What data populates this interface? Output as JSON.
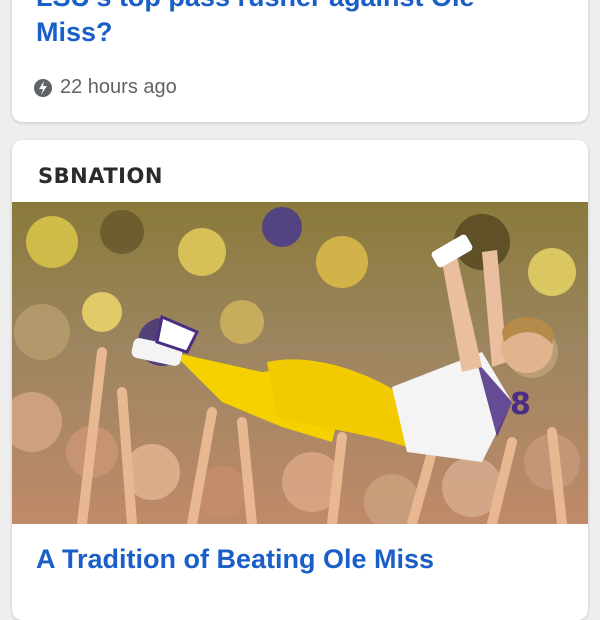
{
  "top_card": {
    "title_line1": "LSU's top pass rusher against Ole",
    "title_line2": "Miss?",
    "time": "22 hours ago"
  },
  "bottom_card": {
    "source": "SBNATION",
    "title": "A Tradition of Beating Ole Miss",
    "jersey_number": "8"
  },
  "colors": {
    "link": "#1a5fc8",
    "meta": "#5f6368",
    "uniform_gold": "#f5d100",
    "uniform_purple": "#4b2e83"
  }
}
